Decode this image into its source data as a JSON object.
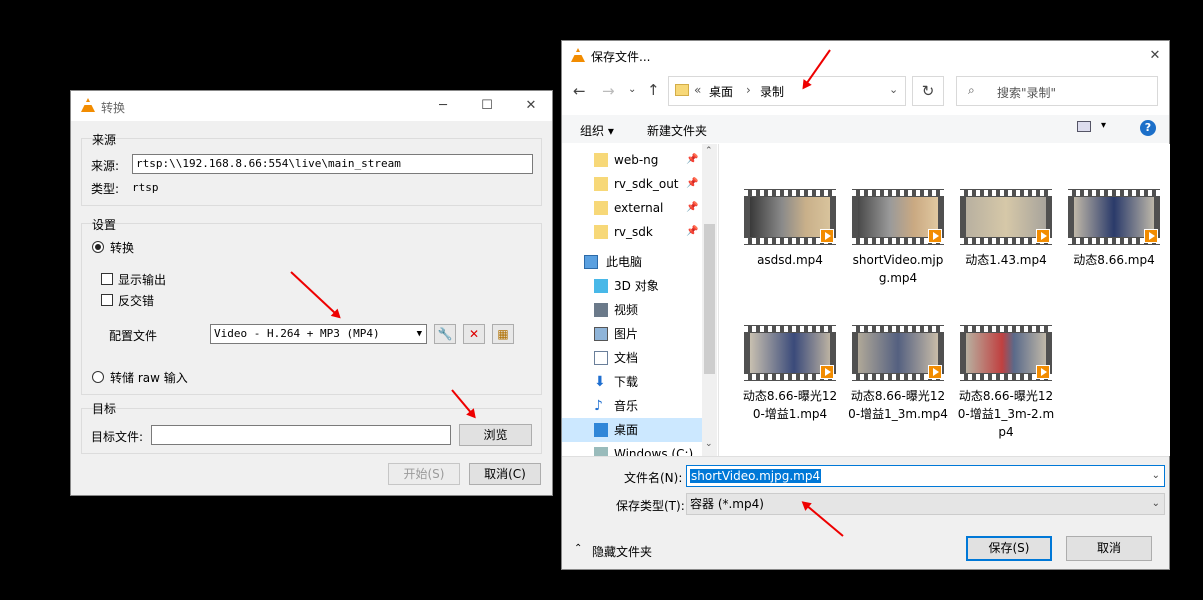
{
  "convert": {
    "title": "转换",
    "source_group": "来源",
    "source_label": "来源:",
    "source_value": "rtsp:\\\\192.168.8.66:554\\live\\main_stream",
    "type_label": "类型:",
    "type_value": "rtsp",
    "settings_group": "设置",
    "convert_radio": "转换",
    "show_output": "显示输出",
    "deinterlace": "反交错",
    "profile_label": "配置文件",
    "profile_value": "Video - H.264 + MP3 (MP4)",
    "dump_raw": "转储 raw 输入",
    "dest_group": "目标",
    "dest_file_label": "目标文件:",
    "dest_file_value": "",
    "browse": "浏览",
    "start": "开始(S)",
    "cancel": "取消(C)"
  },
  "save": {
    "title": "保存文件...",
    "breadcrumb": [
      "桌面",
      "录制"
    ],
    "breadcrumb_prefix": "«",
    "search_placeholder": "搜索\"录制\"",
    "organize": "组织",
    "new_folder": "新建文件夹",
    "nav": [
      {
        "label": "web-ng",
        "pinned": true,
        "icon": "folder-icon"
      },
      {
        "label": "rv_sdk_out",
        "pinned": true,
        "icon": "folder-icon"
      },
      {
        "label": "external",
        "pinned": true,
        "icon": "folder-icon"
      },
      {
        "label": "rv_sdk",
        "pinned": true,
        "icon": "folder-icon"
      },
      {
        "label": "此电脑",
        "pinned": false,
        "icon": "computer-icon"
      },
      {
        "label": "3D 对象",
        "pinned": false,
        "icon": "cube-icon"
      },
      {
        "label": "视频",
        "pinned": false,
        "icon": "video-icon"
      },
      {
        "label": "图片",
        "pinned": false,
        "icon": "picture-icon"
      },
      {
        "label": "文档",
        "pinned": false,
        "icon": "document-icon"
      },
      {
        "label": "下载",
        "pinned": false,
        "icon": "download-icon"
      },
      {
        "label": "音乐",
        "pinned": false,
        "icon": "music-icon"
      },
      {
        "label": "桌面",
        "pinned": false,
        "icon": "desktop-icon"
      },
      {
        "label": "Windows (C:)",
        "pinned": false,
        "icon": "drive-icon"
      }
    ],
    "files": [
      {
        "name": "asdsd.mp4"
      },
      {
        "name": "shortVideo.mjpg.mp4"
      },
      {
        "name": "动态1.43.mp4"
      },
      {
        "name": "动态8.66.mp4"
      },
      {
        "name": "动态8.66-曝光120-增益1.mp4"
      },
      {
        "name": "动态8.66-曝光120-增益1_3m.mp4"
      },
      {
        "name": "动态8.66-曝光120-增益1_3m-2.mp4"
      }
    ],
    "filename_label": "文件名(N):",
    "filename_value": "shortVideo.mjpg.mp4",
    "filetype_label": "保存类型(T):",
    "filetype_value": "容器 (*.mp4)",
    "hide_folders": "隐藏文件夹",
    "save_button": "保存(S)",
    "cancel_button": "取消"
  },
  "colors": {
    "accent": "#0078d7",
    "vlc_orange": "#f28c00",
    "annotation_red": "#e00000"
  }
}
